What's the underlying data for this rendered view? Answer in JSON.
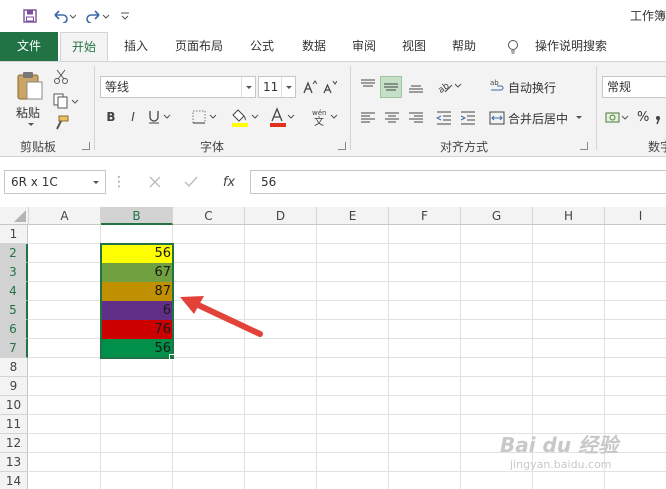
{
  "titlebar": {
    "title": "工作簿"
  },
  "tabs": [
    "文件",
    "开始",
    "插入",
    "页面布局",
    "公式",
    "数据",
    "审阅",
    "视图",
    "帮助"
  ],
  "tell_me": "操作说明搜索",
  "clipboard": {
    "paste": "粘贴",
    "group_label": "剪贴板"
  },
  "font": {
    "name": "等线",
    "size": "11",
    "group_label": "字体",
    "font_color": "#e0301e",
    "fill_color": "#ffff00"
  },
  "alignment": {
    "wrap": "自动换行",
    "merge": "合并后居中",
    "group_label": "对齐方式"
  },
  "number": {
    "format": "常规",
    "percent": "%",
    "group_label": "数字"
  },
  "formula_bar": {
    "name_box": "6R x 1C",
    "fx": "fx",
    "value": "56"
  },
  "columns": [
    "A",
    "B",
    "C",
    "D",
    "E",
    "F",
    "G",
    "H",
    "I"
  ],
  "rows": [
    "1",
    "2",
    "3",
    "4",
    "5",
    "6",
    "7",
    "8",
    "9",
    "10",
    "11",
    "12",
    "13",
    "14"
  ],
  "cells_b": [
    {
      "row": "2",
      "value": "56",
      "fill": "#ffff00"
    },
    {
      "row": "3",
      "value": "67",
      "fill": "#70a03f"
    },
    {
      "row": "4",
      "value": "87",
      "fill": "#c09000"
    },
    {
      "row": "5",
      "value": "6",
      "fill": "#602e86"
    },
    {
      "row": "6",
      "value": "76",
      "fill": "#cc0000"
    },
    {
      "row": "7",
      "value": "56",
      "fill": "#00904a"
    }
  ],
  "selection_color": "#217346",
  "watermark": {
    "text": "Bai du 经验",
    "sub": "jingyan.baidu.com"
  }
}
